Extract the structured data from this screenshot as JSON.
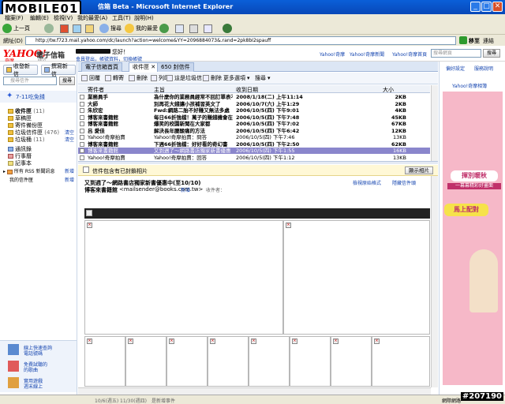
{
  "window": {
    "title": "信箱 Beta - Microsoft Internet Explorer",
    "overlay_logo": "MOBILE01",
    "watermark": "#207190"
  },
  "menu": [
    "檔案(F)",
    "編輯(E)",
    "檢視(V)",
    "我的最愛(A)",
    "工具(T)",
    "說明(H)"
  ],
  "toolbar": {
    "back": "上一頁",
    "search": "搜尋",
    "favorites": "我的最愛"
  },
  "address": {
    "label": "網址(D)",
    "url": "http://tw.f723.mail.yahoo.com/dc/launch?action=welcome&YY=2096884073&.rand=2pk8bI2spauff",
    "go": "移至",
    "links": "連結"
  },
  "yahoo_header": {
    "logo": "YAHOO!",
    "logo_sub": "奇摩",
    "service": "電子信箱",
    "badge": "BETA",
    "greeting": "您好！",
    "user_links": "會員登出，帳號資料，切換帳號",
    "top_links": [
      "Yahoo!奇摩",
      "Yahoo!奇摩新聞",
      "Yahoo!奇摩首頁"
    ],
    "search_placeholder": "搜尋網頁",
    "search_btn": "搜尋",
    "preferences": "偏好設定",
    "help": "服務說明"
  },
  "left_nav": {
    "check_mail": "收發新信",
    "compose": "撰寫新信",
    "search_placeholder": "搜尋信件",
    "search_btn": "搜尋",
    "promo": "7-11吃免錢",
    "folders": [
      {
        "name": "收件匣",
        "count": "(11)"
      },
      {
        "name": "草稿匣",
        "count": ""
      },
      {
        "name": "寄件備份匣",
        "count": ""
      },
      {
        "name": "垃圾信件匣",
        "count": "(476)",
        "action": "清空"
      },
      {
        "name": "垃圾桶",
        "count": "(11)",
        "action": "清空"
      }
    ],
    "others": [
      "通訊錄",
      "行事曆",
      "記事本"
    ],
    "rss": "所有 RSS 新聞訊息",
    "rss_action": "新增",
    "my_folders": "我的信件匣",
    "my_folders_action": "新增",
    "bottom_links": [
      [
        "線上快速查詢",
        "電話號碼"
      ],
      [
        "免費試聽的",
        "的歌曲"
      ],
      [
        "實用遊戲",
        "週末線上"
      ]
    ]
  },
  "tabs": [
    {
      "label": "電子信箱首頁"
    },
    {
      "label": "收件匣"
    },
    {
      "label": "650 封信件"
    }
  ],
  "mail_toolbar": [
    "回覆",
    "轉寄",
    "刪除",
    "列印",
    "這是垃圾信",
    "刪除",
    "更多選項",
    "搜尋"
  ],
  "columns": {
    "sender": "寄件者",
    "subject": "主旨",
    "date": "收到日期",
    "size": "大小"
  },
  "messages": [
    {
      "from": "業務員手",
      "subject": "為什麼你的業務員經常不回訂單表不完?!",
      "date": "2008/1/18(二) 上午11:14",
      "size": "2KB",
      "unread": true
    },
    {
      "from": "大師",
      "subject": "別再花大錢讓小孩補習英文了",
      "date": "2006/10/7(六) 上午1:29",
      "size": "2KB",
      "unread": true
    },
    {
      "from": "朱欣宏",
      "subject": "Fwd:網路二胎不好賺又無法多處",
      "date": "2006/10/5(四) 下午9:01",
      "size": "4KB",
      "unread": true
    },
    {
      "from": "博客來書籍館",
      "subject": "每日66折強檔！萬子的賺錢機會在那裡",
      "date": "2006/10/5(四) 下午7:48",
      "size": "45KB",
      "unread": true
    },
    {
      "from": "博客來書籍館",
      "subject": "爆笑的校園新聞在大家都",
      "date": "2006/10/5(四) 下午7:02",
      "size": "67KB",
      "unread": true
    },
    {
      "from": "呂 愛佳",
      "subject": "解決長年腰酸痛的方法",
      "date": "2006/10/5(四) 下午6:42",
      "size": "12KB",
      "unread": true
    },
    {
      "from": "Yahoo!奇摩拍賣",
      "subject": "Yahoo!奇摩拍賣：問答",
      "date": "2006/10/5(四) 下午7:46",
      "size": "13KB",
      "unread": false
    },
    {
      "from": "博客來書籍館",
      "subject": "下週66折強檔：好好看的奇幻書",
      "date": "2006/10/5(四) 下午2:50",
      "size": "62KB",
      "unread": true
    },
    {
      "from": "博客來書籍館",
      "subject": "又到週了～網路書店獨家新書優惠",
      "date": "2006/10/5(四) 下午1:55",
      "size": "16KB",
      "unread": false,
      "selected": true
    },
    {
      "from": "Yahoo!奇摩拍賣",
      "subject": "Yahoo!奇摩拍賣：回答",
      "date": "2006/10/5(四) 下午1:12",
      "size": "13KB",
      "unread": false
    }
  ],
  "reading_pane": {
    "image_notice": "信件包含有已封鎖相片",
    "show_images": "顯示相片",
    "subject": "又到週了～網路書店獨家新書優惠中(至10/10)",
    "from_name": "博客來書籍館",
    "from_email": "<mailsender@books.com.tw>",
    "add_contact": "新增",
    "to_label": "收件者：",
    "links": [
      "檢視原始格式",
      "隱藏信件頭"
    ],
    "menu_label": "信件選單"
  },
  "right_panel": {
    "title": "Yahoo!奇摩相簿",
    "ad_line1": "揮別暖秋",
    "ad_line2": "一幕幕精彩好畫面",
    "ad_cta": "馬上配對"
  },
  "status": {
    "left": "10/6(週五)",
    "mid": "11/30(週四)",
    "right": "是新增事件",
    "zone": "網際網路"
  }
}
